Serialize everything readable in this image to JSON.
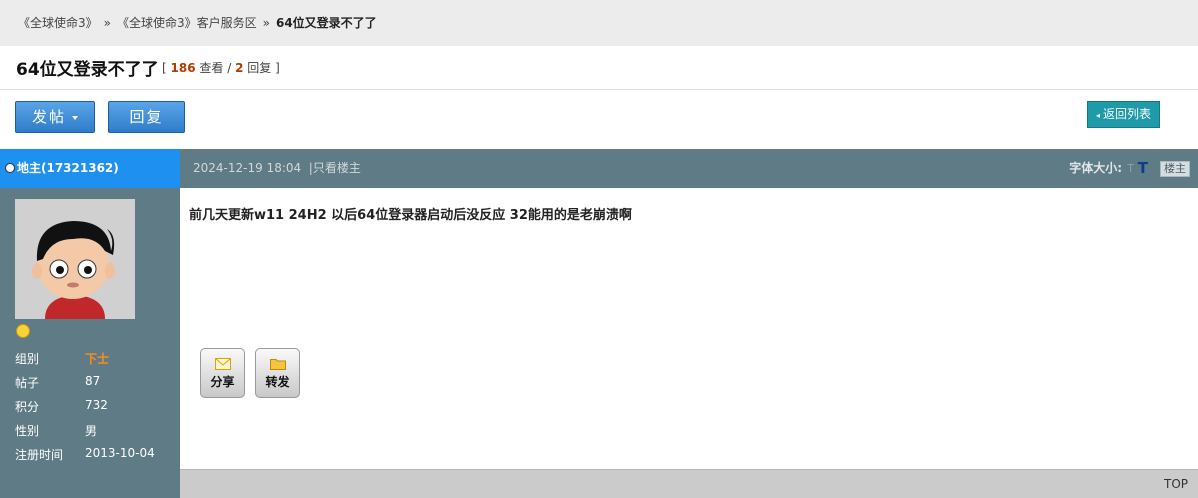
{
  "breadcrumb": {
    "items": [
      "《全球使命3》",
      "《全球使命3》客户服务区",
      "64位又登录不了了"
    ],
    "separator": "»"
  },
  "thread": {
    "title": "64位又登录不了了",
    "views": "186",
    "views_label": "查看",
    "replies": "2",
    "replies_label": "回复"
  },
  "toolbar": {
    "post_label": "发帖",
    "reply_label": "回复",
    "back_label": "返回列表"
  },
  "author": {
    "name": "地主(17321362)",
    "fields": [
      {
        "label": "组别",
        "value": "下士"
      },
      {
        "label": "帖子",
        "value": "87"
      },
      {
        "label": "积分",
        "value": "732"
      },
      {
        "label": "性别",
        "value": "男"
      },
      {
        "label": "注册时间",
        "value": "2013-10-04"
      }
    ]
  },
  "post": {
    "date": "2024-12-19 18:04",
    "only_author": "只看楼主",
    "font_size_label": "字体大小:",
    "font_small": "T",
    "font_big": "T",
    "floor_label": "楼主",
    "content": "前几天更新w11 24H2 以后64位登录器启动后没反应  32能用的是老崩溃啊",
    "actions": {
      "share": "分享",
      "forward": "转发"
    }
  },
  "footer": {
    "top_label": "TOP"
  },
  "colors": {
    "accent": "#1e90f0",
    "sidebar": "#5f7b86",
    "rank": "#ff8c1a",
    "back_button": "#1e9aa8"
  }
}
